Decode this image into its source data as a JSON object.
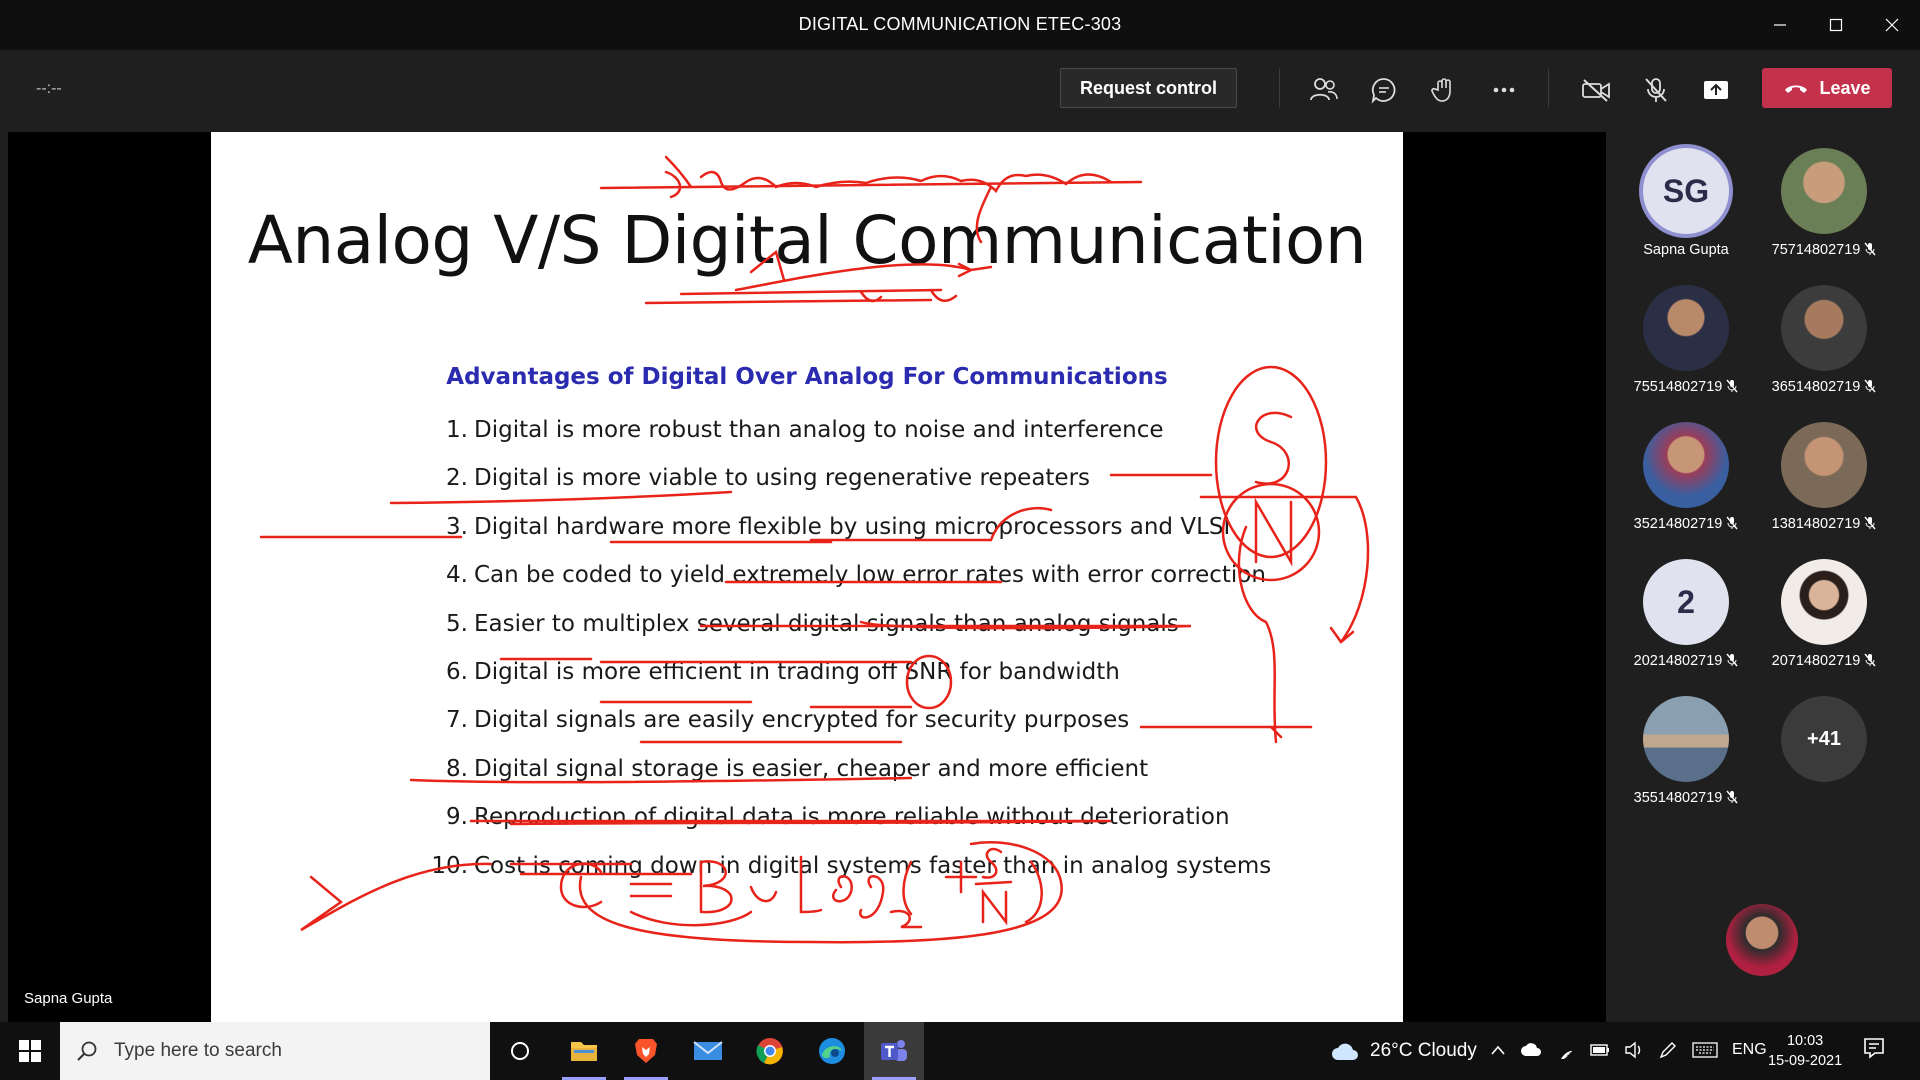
{
  "window": {
    "title": "DIGITAL COMMUNICATION ETEC-303"
  },
  "toolbar": {
    "timer": "--:--",
    "request_control": "Request control",
    "leave": "Leave"
  },
  "slide": {
    "title": "Analog V/S Digital Communication",
    "subtitle": "Advantages of Digital Over Analog For Communications",
    "items": [
      {
        "n": "1.",
        "text": "Digital is more robust than analog to noise and interference"
      },
      {
        "n": "2.",
        "text": "Digital is more viable to using regenerative repeaters"
      },
      {
        "n": "3.",
        "text": "Digital hardware more flexible by using microprocessors and VLSI"
      },
      {
        "n": "4.",
        "text": "Can be coded to yield extremely low error rates with error correction"
      },
      {
        "n": "5.",
        "text": "Easier to multiplex several digital signals than analog signals"
      },
      {
        "n": "6.",
        "text": "Digital is more efficient in trading off SNR for bandwidth"
      },
      {
        "n": "7.",
        "text": "Digital signals are easily encrypted for security purposes"
      },
      {
        "n": "8.",
        "text": "Digital signal storage is easier, cheaper and more efficient"
      },
      {
        "n": "9.",
        "text": "Reproduction of digital data is more reliable without deterioration"
      },
      {
        "n": "10.",
        "text": "Cost is coming down in digital systems faster than in analog systems"
      }
    ]
  },
  "presenter_label": "Sapna Gupta",
  "participants": [
    {
      "name": "Sapna Gupta",
      "initials": "SG",
      "muted": false,
      "kind": "initials-ring"
    },
    {
      "name": "75714802719",
      "muted": true,
      "kind": "photo",
      "color": "#6a7f55"
    },
    {
      "name": "75514802719",
      "muted": true,
      "kind": "photo",
      "color": "#3b4a6b"
    },
    {
      "name": "36514802719",
      "muted": true,
      "kind": "photo",
      "color": "#4a4a4a"
    },
    {
      "name": "35214802719",
      "muted": true,
      "kind": "photo",
      "color": "#9a3d5a"
    },
    {
      "name": "13814802719",
      "muted": true,
      "kind": "photo",
      "color": "#7c6a58"
    },
    {
      "name": "20214802719",
      "initials": "2",
      "muted": true,
      "kind": "initials"
    },
    {
      "name": "20714802719",
      "muted": true,
      "kind": "photo",
      "color": "#d8cfc8"
    },
    {
      "name": "35514802719",
      "muted": true,
      "kind": "photo",
      "color": "#8aa0b0"
    },
    {
      "name": "",
      "initials": "+41",
      "muted": false,
      "kind": "more"
    }
  ],
  "taskbar": {
    "search_placeholder": "Type here to search",
    "weather": "26°C  Cloudy",
    "lang": "ENG",
    "time": "10:03",
    "date": "15-09-2021"
  },
  "colors": {
    "leave": "#c4314b",
    "accent": "#8f90cf",
    "ink": "#e8231a",
    "subtitle": "#2b2bb0"
  }
}
